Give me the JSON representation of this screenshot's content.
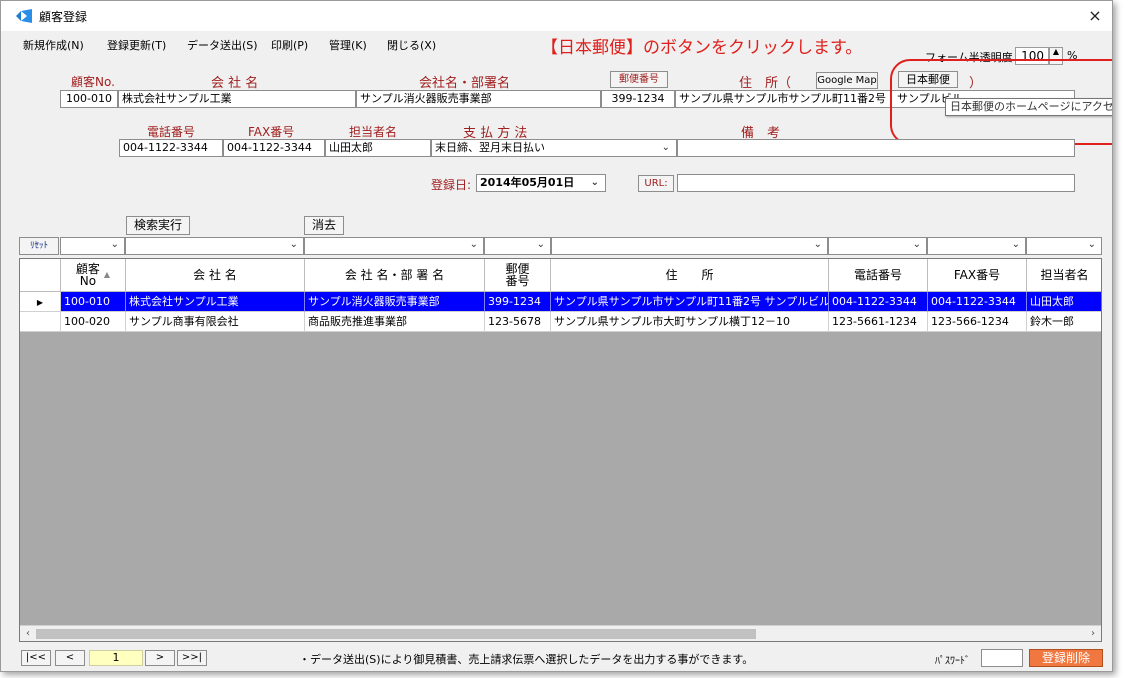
{
  "window": {
    "title": "顧客登録",
    "close": "×"
  },
  "menu": [
    "新規作成(N)",
    "登録更新(T)",
    "データ送出(S)",
    "印刷(P)",
    "管理(K)",
    "閉じる(X)"
  ],
  "instruction": "【日本郵便】のボタンをクリックします。",
  "opacity": {
    "label": "フォーム半透明度",
    "value": "100",
    "unit": "%",
    "spin": "▲"
  },
  "labels": {
    "customer_no": "顧客No.",
    "company": "会 社 名",
    "department": "会社名・部署名",
    "postal_btn": "郵便番号",
    "address": "住　所（",
    "address_close": "）",
    "phone": "電話番号",
    "fax": "FAX番号",
    "contact": "担当者名",
    "payment": "支 払 方 法",
    "remarks": "備　考",
    "reg_date": "登録日:",
    "url": "URL:"
  },
  "buttons": {
    "google_map": "Google Map",
    "japan_post": "日本郵便",
    "search": "検索実行",
    "clear": "消去",
    "reset": "ﾘｾｯﾄ",
    "delete": "登録削除"
  },
  "tooltip": "日本郵便のホームページにアクセスします",
  "form": {
    "customer_no": "100-010",
    "company": "株式会社サンプル工業",
    "department": "サンプル消火器販売事業部",
    "postal": "399-1234",
    "address": "サンプル県サンプル市サンプル町11番2号　サンプルビル",
    "phone": "004-1122-3344",
    "fax": "004-1122-3344",
    "contact": "山田太郎",
    "payment": "末日締、翌月末日払い",
    "remarks": "",
    "reg_date": "2014年05月01日",
    "url": ""
  },
  "grid": {
    "headers": [
      "顧客\nNo",
      "会 社 名",
      "会 社 名・部 署 名",
      "郵便\n番号",
      "住　　所",
      "電話番号",
      "FAX番号",
      "担当者名"
    ],
    "rows": [
      [
        "100-010",
        "株式会社サンプル工業",
        "サンプル消火器販売事業部",
        "399-1234",
        "サンプル県サンプル市サンプル町11番2号 サンプルビル…",
        "004-1122-3344",
        "004-1122-3344",
        "山田太郎"
      ],
      [
        "100-020",
        "サンプル商事有限会社",
        "商品販売推進事業部",
        "123-5678",
        "サンプル県サンプル市大町サンプル横丁12－10",
        "123-5661-1234",
        "123-566-1234",
        "鈴木一郎"
      ]
    ]
  },
  "nav": {
    "first": "|<<",
    "prev": "<",
    "page": "1",
    "next": ">",
    "last": ">>|"
  },
  "footnote": "・データ送出(S)により御見積書、売上請求伝票へ選択したデータを出力する事ができます。",
  "password_label": "ﾊﾟｽﾜｰﾄﾞ",
  "colors": {
    "selected_row": "#0000ff",
    "annotation": "#e0201c",
    "delete_button": "#f07840"
  }
}
